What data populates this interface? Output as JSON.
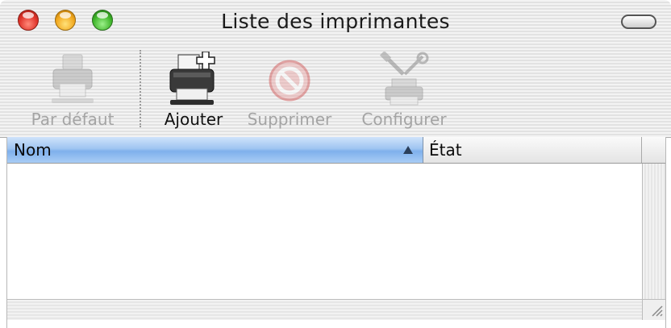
{
  "window": {
    "title": "Liste des imprimantes"
  },
  "toolbar": {
    "items": [
      {
        "label": "Par défaut",
        "icon": "printer-default-icon",
        "enabled": false
      },
      {
        "label": "Ajouter",
        "icon": "add-printer-icon",
        "enabled": true
      },
      {
        "label": "Supprimer",
        "icon": "delete-icon",
        "enabled": false
      },
      {
        "label": "Configurer",
        "icon": "configure-icon",
        "enabled": false
      }
    ]
  },
  "table": {
    "columns": [
      {
        "label": "Nom",
        "sorted": true,
        "sort_direction": "ascending"
      },
      {
        "label": "État",
        "sorted": false
      }
    ],
    "rows": []
  },
  "colors": {
    "close": "#e0332a",
    "minimize": "#f2a81e",
    "zoom": "#3fb52a",
    "header_selected": "#9fc5f1",
    "disabled_text": "#a4a4a4"
  }
}
